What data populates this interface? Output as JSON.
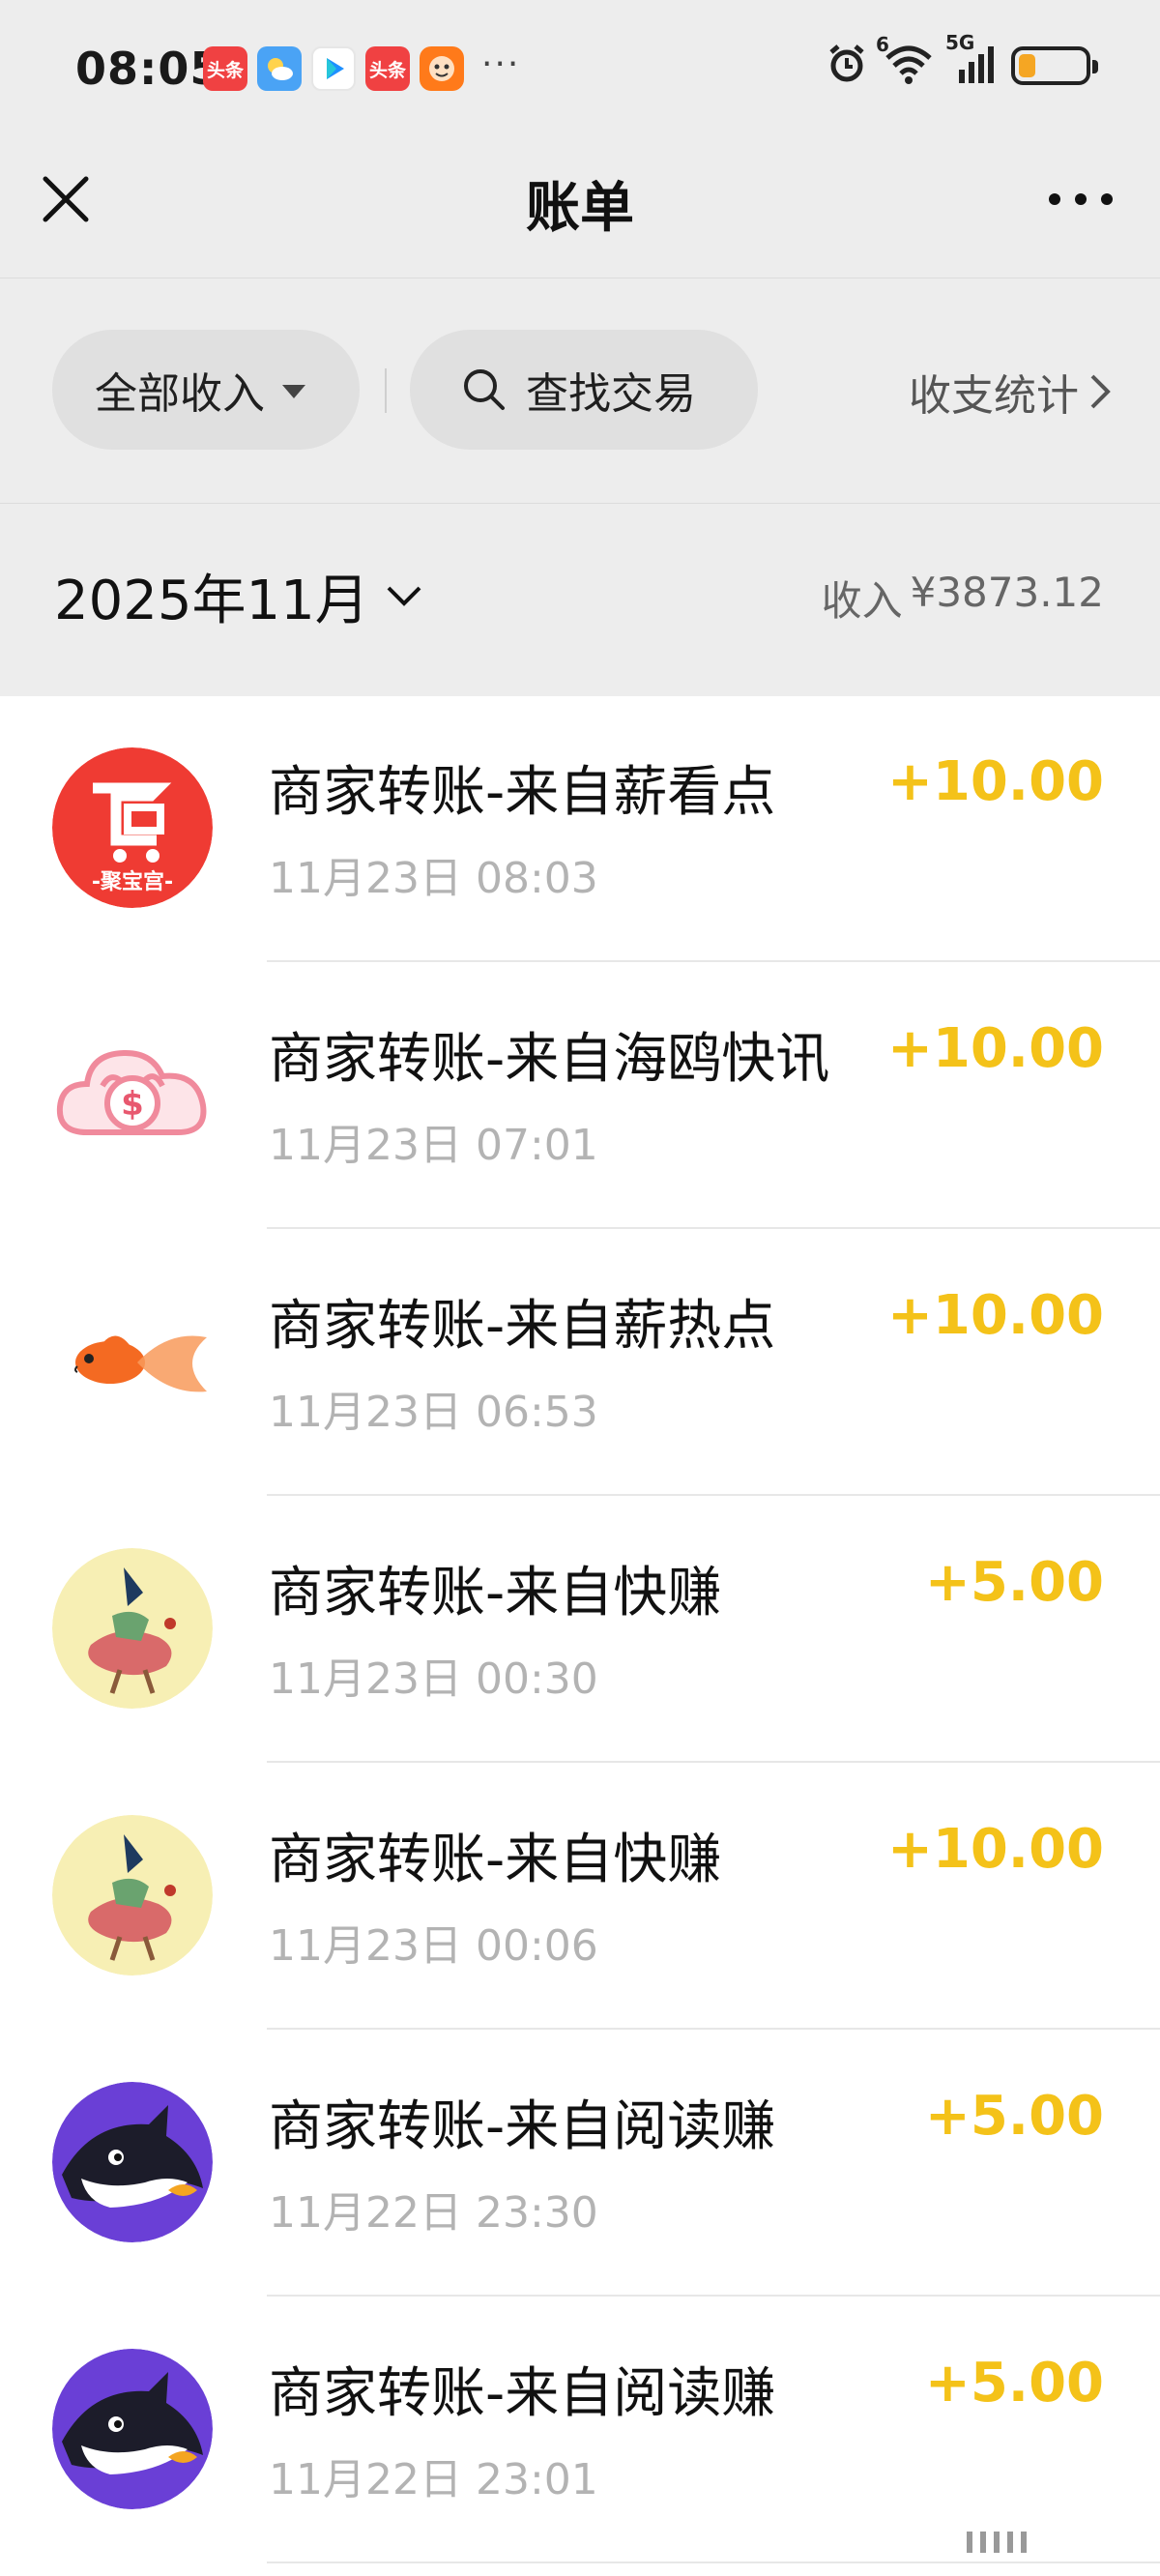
{
  "status_bar": {
    "time": "08:05",
    "notifications": [
      {
        "icon": "toutiao-icon",
        "label": "头条"
      },
      {
        "icon": "weather-icon",
        "label": ""
      },
      {
        "icon": "video-icon",
        "label": ""
      },
      {
        "icon": "toutiao-icon",
        "label": "头条"
      },
      {
        "icon": "game-icon",
        "label": ""
      }
    ],
    "more": "···",
    "network": "5G",
    "signal_badge": "6",
    "battery_level": 0.25,
    "battery_color": "#f5a623"
  },
  "navbar": {
    "title": "账单",
    "close_icon": "close-icon",
    "more_icon": "more-icon"
  },
  "filters": {
    "income_filter": "全部收入",
    "search": "查找交易",
    "stats": "收支统计"
  },
  "month": {
    "label": "2025年11月",
    "income_label": "收入",
    "income_amount": "¥3873.12"
  },
  "accent_color": "#f4c219",
  "transactions": [
    {
      "title": "商家转账-来自薪看点",
      "time": "11月23日 08:03",
      "amount": "+10.00",
      "avatar": "jubaogong-logo",
      "avatar_text": "-聚宝宫-"
    },
    {
      "title": "商家转账-来自海鸥快讯",
      "time": "11月23日 07:01",
      "amount": "+10.00",
      "avatar": "cloud-money-logo",
      "avatar_text": "$"
    },
    {
      "title": "商家转账-来自薪热点",
      "time": "11月23日 06:53",
      "amount": "+10.00",
      "avatar": "goldfish-logo",
      "avatar_text": ""
    },
    {
      "title": "商家转账-来自快赚",
      "time": "11月23日 00:30",
      "amount": "+5.00",
      "avatar": "kuaizhuan-logo",
      "avatar_text": ""
    },
    {
      "title": "商家转账-来自快赚",
      "time": "11月23日 00:06",
      "amount": "+10.00",
      "avatar": "kuaizhuan-logo",
      "avatar_text": ""
    },
    {
      "title": "商家转账-来自阅读赚",
      "time": "11月22日 23:30",
      "amount": "+5.00",
      "avatar": "shark-logo",
      "avatar_text": ""
    },
    {
      "title": "商家转账-来自阅读赚",
      "time": "11月22日 23:01",
      "amount": "+5.00",
      "avatar": "shark-logo",
      "avatar_text": ""
    }
  ]
}
